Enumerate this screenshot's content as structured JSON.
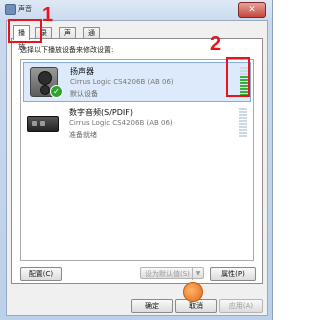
{
  "window": {
    "title": "声音",
    "close_label": "✕"
  },
  "tabs": [
    {
      "label": "播放",
      "active": true
    },
    {
      "label": "录制",
      "active": false
    },
    {
      "label": "声音",
      "active": false
    },
    {
      "label": "通信",
      "active": false
    }
  ],
  "instruction": "选择以下播放设备来修改设置:",
  "devices": [
    {
      "name": "扬声器",
      "description": "Cirrus Logic CS4206B (AB 06)",
      "status": "默认设备",
      "icon": "speaker-icon",
      "default": true,
      "selected": true,
      "level_segments_on": 7,
      "level_segments_total": 10
    },
    {
      "name": "数字音频(S/PDIF)",
      "description": "Cirrus Logic CS4206B (AB 06)",
      "status": "准备就绪",
      "icon": "spdif-icon",
      "default": false,
      "selected": false,
      "level_segments_on": 0,
      "level_segments_total": 10
    }
  ],
  "buttons": {
    "configure": "配置(C)",
    "set_default": "设为默认值(S)",
    "set_default_arrow": "▼",
    "properties": "属性(P)",
    "ok": "确定",
    "cancel": "取消",
    "apply": "应用(A)"
  },
  "annotations": {
    "marker_1": "1",
    "marker_2": "2"
  },
  "colors": {
    "annotation_red": "#e8141c",
    "level_green": "#37b037",
    "selection_blue": "#dceafb"
  }
}
